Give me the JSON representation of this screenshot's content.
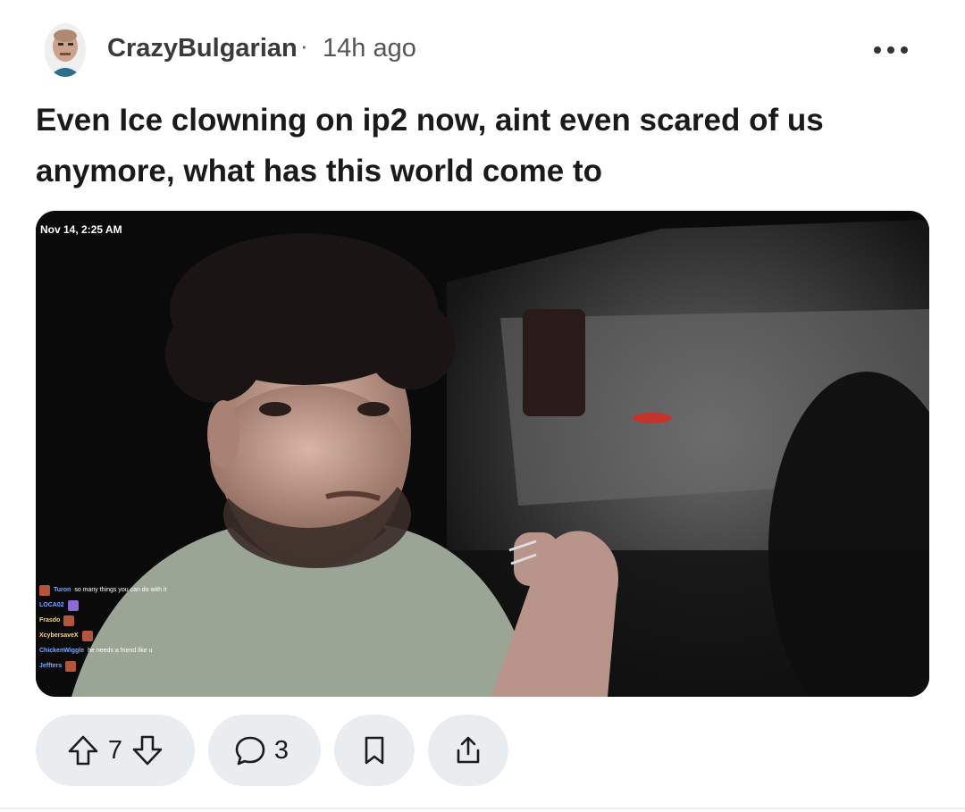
{
  "post": {
    "author": "CrazyBulgarian",
    "separator": "·",
    "time": "14h ago",
    "title": "Even Ice clowning on ip2 now, aint even scared of us anymore, what has this world come to"
  },
  "media": {
    "timestamp": "Nov 14, 2:25 AM",
    "chat": [
      {
        "name": "Turon",
        "text": "so many things you can do with it"
      },
      {
        "name": "LOCA02",
        "text": ""
      },
      {
        "name": "Frasdo",
        "text": ""
      },
      {
        "name": "XcybersaveX",
        "text": ""
      },
      {
        "name": "ChickenWiggle",
        "text": "he needs a friend like u"
      },
      {
        "name": "Jeffters",
        "text": ""
      }
    ]
  },
  "actions": {
    "votes": "7",
    "comments": "3"
  },
  "icons": {
    "upvote": "arrow-up-outline-icon",
    "downvote": "arrow-down-outline-icon",
    "comment": "speech-bubble-icon",
    "save": "bookmark-icon",
    "share": "share-icon",
    "more": "ellipsis-icon"
  },
  "colors": {
    "pill_bg": "#eaedef",
    "text": "#1c1c1c"
  }
}
